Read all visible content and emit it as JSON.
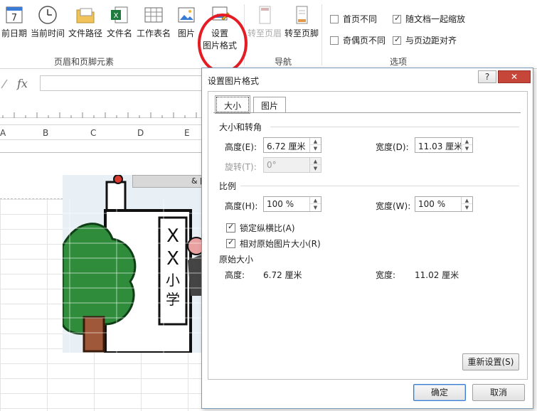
{
  "ribbon": {
    "buttons": [
      {
        "label": "前日期"
      },
      {
        "label": "当前时间"
      },
      {
        "label": "文件路径"
      },
      {
        "label": "文件名"
      },
      {
        "label": "工作表名"
      },
      {
        "label": "图片"
      },
      {
        "label": "设置",
        "label2": "图片格式"
      },
      {
        "label": "转至页眉"
      },
      {
        "label": "转至页脚"
      }
    ],
    "groups": {
      "elements": "页眉和页脚元素",
      "nav": "导航",
      "options": "选项"
    },
    "options": [
      {
        "label": "首页不同",
        "checked": false
      },
      {
        "label": "随文档一起缩放",
        "checked": true
      },
      {
        "label": "奇偶页不同",
        "checked": false
      },
      {
        "label": "与页边距对齐",
        "checked": true
      }
    ],
    "calendar_day": "7"
  },
  "formula_bar": {
    "fx": "fx"
  },
  "sheet": {
    "columns": [
      "A",
      "B",
      "C",
      "D",
      "E"
    ],
    "header_box_text": "& [",
    "picture_text": [
      "X",
      "X",
      "小",
      "学"
    ]
  },
  "dialog": {
    "title": "设置图片格式",
    "help": "?",
    "close": "✕",
    "tabs": [
      "大小",
      "图片"
    ],
    "size_rotate": {
      "section": "大小和转角",
      "height_label": "高度(E):",
      "height_value": "6.72 厘米",
      "width_label": "宽度(D):",
      "width_value": "11.03 厘米",
      "rotate_label": "旋转(T):",
      "rotate_value": "0°"
    },
    "scale": {
      "section": "比例",
      "height_label": "高度(H):",
      "height_value": "100 %",
      "width_label": "宽度(W):",
      "width_value": "100 %",
      "lock_ratio": "锁定纵横比(A)",
      "relative_original": "相对原始图片大小(R)"
    },
    "original": {
      "section": "原始大小",
      "height_label": "高度:",
      "height_value": "6.72 厘米",
      "width_label": "宽度:",
      "width_value": "11.02 厘米"
    },
    "reset": "重新设置(S)",
    "ok": "确定",
    "cancel": "取消"
  }
}
